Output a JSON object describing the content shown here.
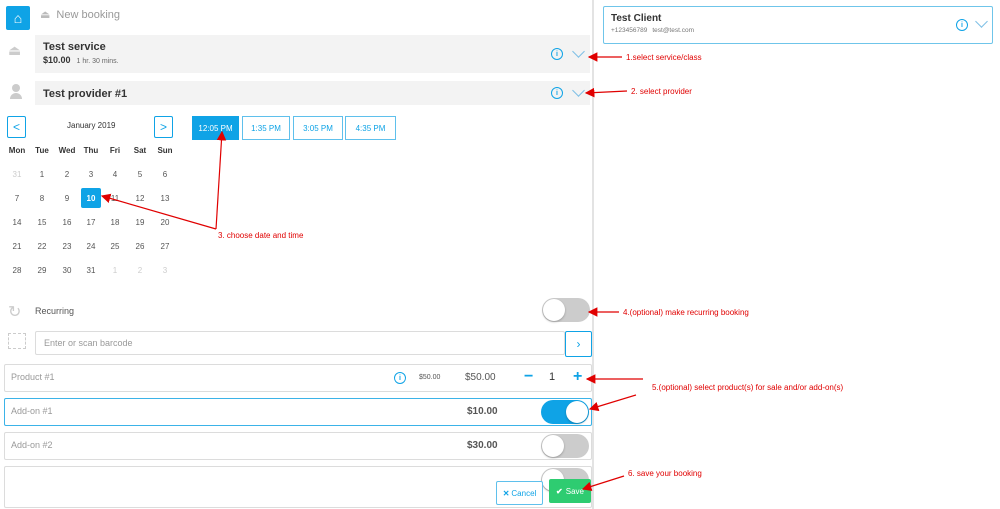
{
  "breadcrumb": {
    "label": "New booking"
  },
  "service": {
    "name": "Test service",
    "price": "$10.00",
    "duration": "1 hr. 30 mins."
  },
  "provider": {
    "name": "Test provider #1"
  },
  "calendar": {
    "month": "January 2019",
    "prev": "<",
    "next": ">",
    "weekdays": [
      "Mon",
      "Tue",
      "Wed",
      "Thu",
      "Fri",
      "Sat",
      "Sun"
    ],
    "weeks": [
      [
        "31",
        "1",
        "2",
        "3",
        "4",
        "5",
        "6"
      ],
      [
        "7",
        "8",
        "9",
        "10",
        "11",
        "12",
        "13"
      ],
      [
        "14",
        "15",
        "16",
        "17",
        "18",
        "19",
        "20"
      ],
      [
        "21",
        "22",
        "23",
        "24",
        "25",
        "26",
        "27"
      ],
      [
        "28",
        "29",
        "30",
        "31",
        "1",
        "2",
        "3"
      ]
    ],
    "selected_day": "10"
  },
  "time_slots": [
    "12:05 PM",
    "1:35 PM",
    "3:05 PM",
    "4:35 PM"
  ],
  "selected_slot": "12:05 PM",
  "recurring": {
    "label": "Recurring",
    "enabled": false
  },
  "barcode": {
    "placeholder": "Enter or scan barcode"
  },
  "product": {
    "name": "Product #1",
    "unit_price": "$50.00",
    "total": "$50.00",
    "quantity": "1",
    "minus": "−",
    "plus": "+"
  },
  "addons": [
    {
      "name": "Add-on #1",
      "price": "$10.00",
      "enabled": true
    },
    {
      "name": "Add-on #2",
      "price": "$30.00",
      "enabled": false
    },
    {
      "name": "",
      "price": "",
      "enabled": false
    }
  ],
  "actions": {
    "cancel": "Cancel",
    "save": "Save"
  },
  "client": {
    "name": "Test Client",
    "phone": "+123456789",
    "email": "test@test.com"
  },
  "annotations": {
    "a1": "1.select service/class",
    "a2": "2. select provider",
    "a3": "3. choose date and time",
    "a4": "4.(optional) make recurring booking",
    "a5": "5.(optional) select product(s) for sale and/or add-on(s)",
    "a6": "6. save your booking"
  },
  "colors": {
    "accent": "#0fa3e6",
    "save": "#2ecc71",
    "annotation": "#e00000"
  }
}
